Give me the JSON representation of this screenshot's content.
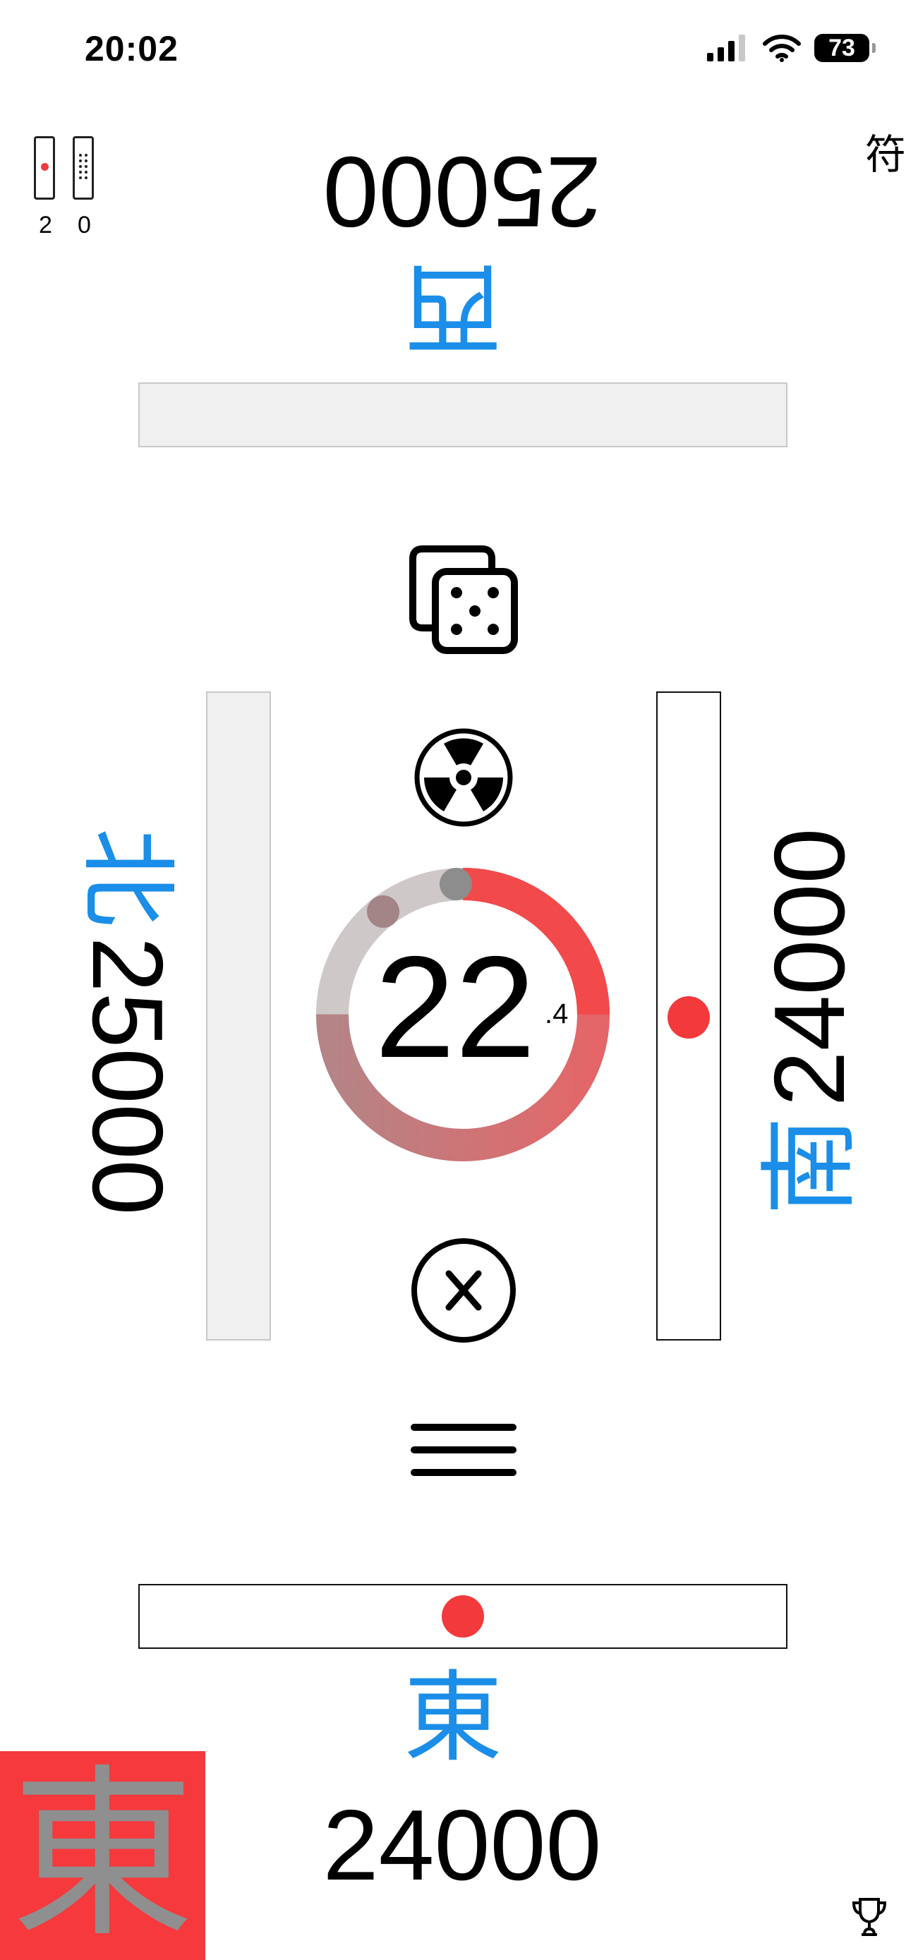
{
  "status_bar": {
    "time": "20:02",
    "battery": "73"
  },
  "counters": {
    "riichi_sticks": "2",
    "honba_sticks": "0"
  },
  "fu_label": "符",
  "players": {
    "west": {
      "wind": "西",
      "score": "25000"
    },
    "north": {
      "wind": "北",
      "score": "25000"
    },
    "south": {
      "wind": "南",
      "score": "24000"
    },
    "east": {
      "wind": "東",
      "score": "24000"
    }
  },
  "timer": {
    "seconds": "22",
    "decimal": ".4",
    "remaining_fraction": 0.75
  },
  "round_wind": "東",
  "colors": {
    "accent_blue": "#1a8ee8",
    "riichi_red": "#f23a3c",
    "round_bg": "#f5393d"
  },
  "icons": [
    "dice-icon",
    "radiation-icon",
    "close-circle-icon",
    "menu-icon",
    "trophy-icon"
  ]
}
